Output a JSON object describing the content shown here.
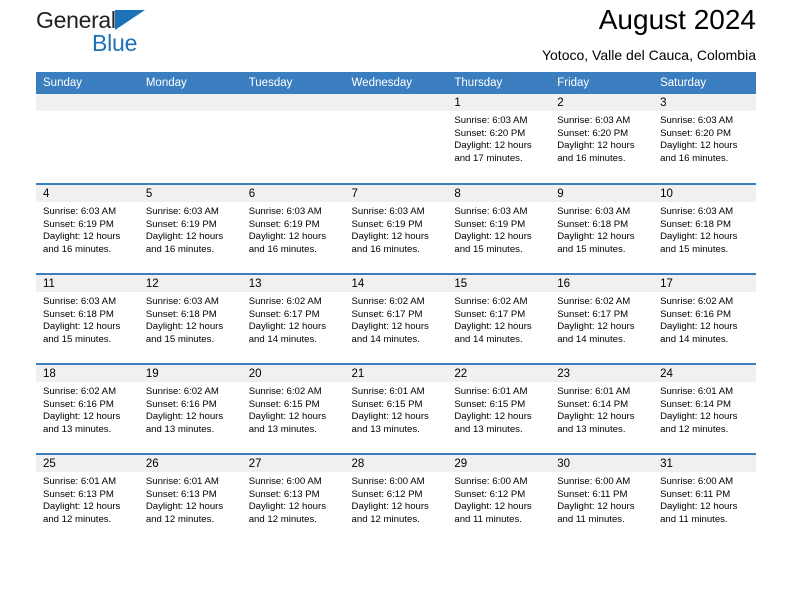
{
  "brand": {
    "name_part_1": "General",
    "name_part_2": "Blue",
    "logo_icon": "triangle-icon",
    "color_dark": "#231f20",
    "color_blue": "#1b72b8"
  },
  "header": {
    "title": "August 2024",
    "subtitle": "Yotoco, Valle del Cauca, Colombia"
  },
  "calendar": {
    "header_background": "#3a7ebf",
    "daynum_background": "#f0f0f0",
    "weekday_headers": [
      "Sunday",
      "Monday",
      "Tuesday",
      "Wednesday",
      "Thursday",
      "Friday",
      "Saturday"
    ],
    "weeks": [
      [
        {
          "day": "",
          "blank": true,
          "sunrise": "",
          "sunset": "",
          "daylight_line_1": "",
          "daylight_line_2": ""
        },
        {
          "day": "",
          "blank": true,
          "sunrise": "",
          "sunset": "",
          "daylight_line_1": "",
          "daylight_line_2": ""
        },
        {
          "day": "",
          "blank": true,
          "sunrise": "",
          "sunset": "",
          "daylight_line_1": "",
          "daylight_line_2": ""
        },
        {
          "day": "",
          "blank": true,
          "sunrise": "",
          "sunset": "",
          "daylight_line_1": "",
          "daylight_line_2": ""
        },
        {
          "day": "1",
          "blank": false,
          "sunrise": "Sunrise: 6:03 AM",
          "sunset": "Sunset: 6:20 PM",
          "daylight_line_1": "Daylight: 12 hours",
          "daylight_line_2": "and 17 minutes."
        },
        {
          "day": "2",
          "blank": false,
          "sunrise": "Sunrise: 6:03 AM",
          "sunset": "Sunset: 6:20 PM",
          "daylight_line_1": "Daylight: 12 hours",
          "daylight_line_2": "and 16 minutes."
        },
        {
          "day": "3",
          "blank": false,
          "sunrise": "Sunrise: 6:03 AM",
          "sunset": "Sunset: 6:20 PM",
          "daylight_line_1": "Daylight: 12 hours",
          "daylight_line_2": "and 16 minutes."
        }
      ],
      [
        {
          "day": "4",
          "blank": false,
          "sunrise": "Sunrise: 6:03 AM",
          "sunset": "Sunset: 6:19 PM",
          "daylight_line_1": "Daylight: 12 hours",
          "daylight_line_2": "and 16 minutes."
        },
        {
          "day": "5",
          "blank": false,
          "sunrise": "Sunrise: 6:03 AM",
          "sunset": "Sunset: 6:19 PM",
          "daylight_line_1": "Daylight: 12 hours",
          "daylight_line_2": "and 16 minutes."
        },
        {
          "day": "6",
          "blank": false,
          "sunrise": "Sunrise: 6:03 AM",
          "sunset": "Sunset: 6:19 PM",
          "daylight_line_1": "Daylight: 12 hours",
          "daylight_line_2": "and 16 minutes."
        },
        {
          "day": "7",
          "blank": false,
          "sunrise": "Sunrise: 6:03 AM",
          "sunset": "Sunset: 6:19 PM",
          "daylight_line_1": "Daylight: 12 hours",
          "daylight_line_2": "and 16 minutes."
        },
        {
          "day": "8",
          "blank": false,
          "sunrise": "Sunrise: 6:03 AM",
          "sunset": "Sunset: 6:19 PM",
          "daylight_line_1": "Daylight: 12 hours",
          "daylight_line_2": "and 15 minutes."
        },
        {
          "day": "9",
          "blank": false,
          "sunrise": "Sunrise: 6:03 AM",
          "sunset": "Sunset: 6:18 PM",
          "daylight_line_1": "Daylight: 12 hours",
          "daylight_line_2": "and 15 minutes."
        },
        {
          "day": "10",
          "blank": false,
          "sunrise": "Sunrise: 6:03 AM",
          "sunset": "Sunset: 6:18 PM",
          "daylight_line_1": "Daylight: 12 hours",
          "daylight_line_2": "and 15 minutes."
        }
      ],
      [
        {
          "day": "11",
          "blank": false,
          "sunrise": "Sunrise: 6:03 AM",
          "sunset": "Sunset: 6:18 PM",
          "daylight_line_1": "Daylight: 12 hours",
          "daylight_line_2": "and 15 minutes."
        },
        {
          "day": "12",
          "blank": false,
          "sunrise": "Sunrise: 6:03 AM",
          "sunset": "Sunset: 6:18 PM",
          "daylight_line_1": "Daylight: 12 hours",
          "daylight_line_2": "and 15 minutes."
        },
        {
          "day": "13",
          "blank": false,
          "sunrise": "Sunrise: 6:02 AM",
          "sunset": "Sunset: 6:17 PM",
          "daylight_line_1": "Daylight: 12 hours",
          "daylight_line_2": "and 14 minutes."
        },
        {
          "day": "14",
          "blank": false,
          "sunrise": "Sunrise: 6:02 AM",
          "sunset": "Sunset: 6:17 PM",
          "daylight_line_1": "Daylight: 12 hours",
          "daylight_line_2": "and 14 minutes."
        },
        {
          "day": "15",
          "blank": false,
          "sunrise": "Sunrise: 6:02 AM",
          "sunset": "Sunset: 6:17 PM",
          "daylight_line_1": "Daylight: 12 hours",
          "daylight_line_2": "and 14 minutes."
        },
        {
          "day": "16",
          "blank": false,
          "sunrise": "Sunrise: 6:02 AM",
          "sunset": "Sunset: 6:17 PM",
          "daylight_line_1": "Daylight: 12 hours",
          "daylight_line_2": "and 14 minutes."
        },
        {
          "day": "17",
          "blank": false,
          "sunrise": "Sunrise: 6:02 AM",
          "sunset": "Sunset: 6:16 PM",
          "daylight_line_1": "Daylight: 12 hours",
          "daylight_line_2": "and 14 minutes."
        }
      ],
      [
        {
          "day": "18",
          "blank": false,
          "sunrise": "Sunrise: 6:02 AM",
          "sunset": "Sunset: 6:16 PM",
          "daylight_line_1": "Daylight: 12 hours",
          "daylight_line_2": "and 13 minutes."
        },
        {
          "day": "19",
          "blank": false,
          "sunrise": "Sunrise: 6:02 AM",
          "sunset": "Sunset: 6:16 PM",
          "daylight_line_1": "Daylight: 12 hours",
          "daylight_line_2": "and 13 minutes."
        },
        {
          "day": "20",
          "blank": false,
          "sunrise": "Sunrise: 6:02 AM",
          "sunset": "Sunset: 6:15 PM",
          "daylight_line_1": "Daylight: 12 hours",
          "daylight_line_2": "and 13 minutes."
        },
        {
          "day": "21",
          "blank": false,
          "sunrise": "Sunrise: 6:01 AM",
          "sunset": "Sunset: 6:15 PM",
          "daylight_line_1": "Daylight: 12 hours",
          "daylight_line_2": "and 13 minutes."
        },
        {
          "day": "22",
          "blank": false,
          "sunrise": "Sunrise: 6:01 AM",
          "sunset": "Sunset: 6:15 PM",
          "daylight_line_1": "Daylight: 12 hours",
          "daylight_line_2": "and 13 minutes."
        },
        {
          "day": "23",
          "blank": false,
          "sunrise": "Sunrise: 6:01 AM",
          "sunset": "Sunset: 6:14 PM",
          "daylight_line_1": "Daylight: 12 hours",
          "daylight_line_2": "and 13 minutes."
        },
        {
          "day": "24",
          "blank": false,
          "sunrise": "Sunrise: 6:01 AM",
          "sunset": "Sunset: 6:14 PM",
          "daylight_line_1": "Daylight: 12 hours",
          "daylight_line_2": "and 12 minutes."
        }
      ],
      [
        {
          "day": "25",
          "blank": false,
          "sunrise": "Sunrise: 6:01 AM",
          "sunset": "Sunset: 6:13 PM",
          "daylight_line_1": "Daylight: 12 hours",
          "daylight_line_2": "and 12 minutes."
        },
        {
          "day": "26",
          "blank": false,
          "sunrise": "Sunrise: 6:01 AM",
          "sunset": "Sunset: 6:13 PM",
          "daylight_line_1": "Daylight: 12 hours",
          "daylight_line_2": "and 12 minutes."
        },
        {
          "day": "27",
          "blank": false,
          "sunrise": "Sunrise: 6:00 AM",
          "sunset": "Sunset: 6:13 PM",
          "daylight_line_1": "Daylight: 12 hours",
          "daylight_line_2": "and 12 minutes."
        },
        {
          "day": "28",
          "blank": false,
          "sunrise": "Sunrise: 6:00 AM",
          "sunset": "Sunset: 6:12 PM",
          "daylight_line_1": "Daylight: 12 hours",
          "daylight_line_2": "and 12 minutes."
        },
        {
          "day": "29",
          "blank": false,
          "sunrise": "Sunrise: 6:00 AM",
          "sunset": "Sunset: 6:12 PM",
          "daylight_line_1": "Daylight: 12 hours",
          "daylight_line_2": "and 11 minutes."
        },
        {
          "day": "30",
          "blank": false,
          "sunrise": "Sunrise: 6:00 AM",
          "sunset": "Sunset: 6:11 PM",
          "daylight_line_1": "Daylight: 12 hours",
          "daylight_line_2": "and 11 minutes."
        },
        {
          "day": "31",
          "blank": false,
          "sunrise": "Sunrise: 6:00 AM",
          "sunset": "Sunset: 6:11 PM",
          "daylight_line_1": "Daylight: 12 hours",
          "daylight_line_2": "and 11 minutes."
        }
      ]
    ]
  }
}
